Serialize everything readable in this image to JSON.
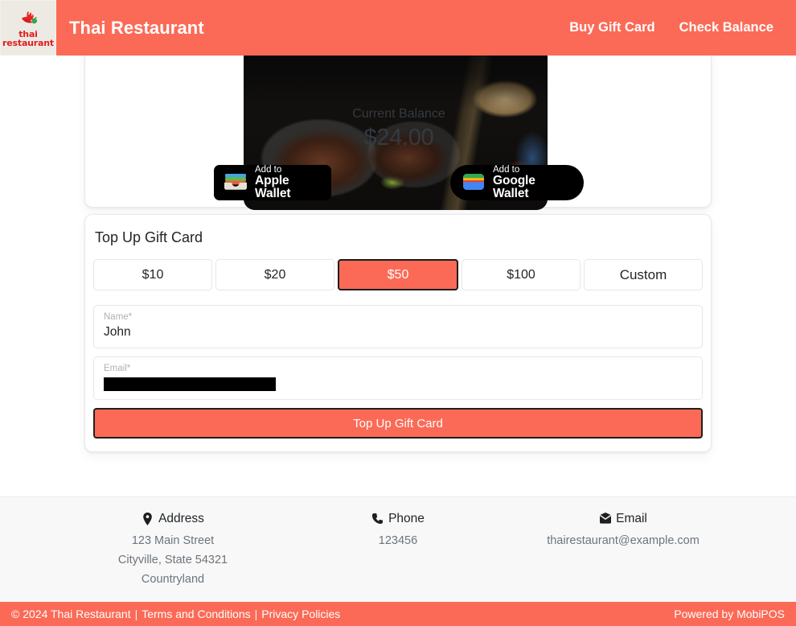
{
  "theme": {
    "accent": "#fb6a56",
    "page_bg": "#ffffff",
    "footer_bg": "#f8f8f8",
    "text": "#212529",
    "muted": "#6c757d",
    "logo_red": "#e02020"
  },
  "header": {
    "logo_icon": "chili-pepper-logo-icon",
    "logo_line1": "thai",
    "logo_line2": "restaurant",
    "brand": "Thai Restaurant",
    "nav": [
      {
        "label": "Buy Gift Card",
        "name": "nav-link-buy-gift-card"
      },
      {
        "label": "Check Balance",
        "name": "nav-link-check-balance"
      }
    ]
  },
  "balance_card": {
    "gift_card_image_alt": "thai-food-gift-card-image",
    "balance_label": "Current Balance",
    "balance_amount": "$24.00",
    "wallets": [
      {
        "name": "add-to-apple-wallet-button",
        "line1": "Add to",
        "line2": "Apple Wallet",
        "icon": "apple-wallet-card-icon"
      },
      {
        "name": "add-to-google-wallet-button",
        "line1": "Add to",
        "line2": "Google Wallet",
        "icon": "google-wallet-icon"
      }
    ]
  },
  "topup": {
    "title": "Top Up Gift Card",
    "amounts": [
      {
        "label": "$10",
        "selected": false
      },
      {
        "label": "$20",
        "selected": false
      },
      {
        "label": "$50",
        "selected": true
      },
      {
        "label": "$100",
        "selected": false
      },
      {
        "label": "Custom",
        "selected": false
      }
    ],
    "selected_amount": "$50",
    "fields": [
      {
        "label": "Name*",
        "value": "John",
        "placeholder": "Name*",
        "redacted": false
      },
      {
        "label": "Email*",
        "value": "",
        "placeholder": "Email*",
        "redacted": true
      }
    ],
    "submit_label": "Top Up Gift Card"
  },
  "footer": {
    "columns": [
      {
        "icon": "location-pin-icon",
        "heading": "Address",
        "lines": [
          "123 Main Street",
          "Cityville, State 54321",
          "Countryland"
        ]
      },
      {
        "icon": "phone-icon",
        "heading": "Phone",
        "lines": [
          "123456"
        ]
      },
      {
        "icon": "envelope-icon",
        "heading": "Email",
        "lines": [
          "thairestaurant@example.com"
        ]
      }
    ]
  },
  "bottombar": {
    "copyright": "© 2024 Thai Restaurant",
    "sep1": "|",
    "terms": "Terms and Conditions",
    "sep2": "|",
    "privacy": "Privacy Policies",
    "powered_by": "Powered by MobiPOS"
  }
}
